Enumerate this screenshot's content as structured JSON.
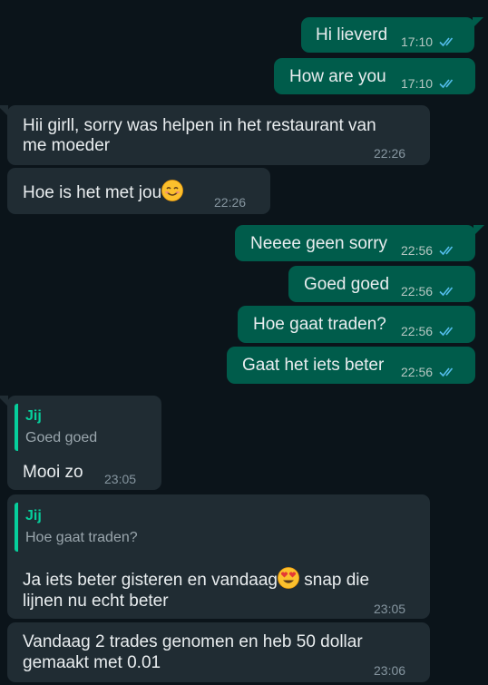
{
  "messages": [
    {
      "id": "m1",
      "dir": "out",
      "text": "Hi lieverd",
      "time": "17:10",
      "status": "read"
    },
    {
      "id": "m2",
      "dir": "out",
      "text": "How are you",
      "time": "17:10",
      "status": "read"
    },
    {
      "id": "m3",
      "dir": "in",
      "lines": [
        "Hii girll, sorry was helpen in het restaurant van",
        "me moeder"
      ],
      "time": "22:26"
    },
    {
      "id": "m4",
      "dir": "in",
      "text": "Hoe is het met jou",
      "emoji": "smiling-face-emoji",
      "time": "22:26"
    },
    {
      "id": "m5",
      "dir": "out",
      "text": "Neeee geen sorry",
      "time": "22:56",
      "status": "read"
    },
    {
      "id": "m6",
      "dir": "out",
      "text": "Goed goed",
      "time": "22:56",
      "status": "read"
    },
    {
      "id": "m7",
      "dir": "out",
      "text": "Hoe gaat traden?",
      "time": "22:56",
      "status": "read"
    },
    {
      "id": "m8",
      "dir": "out",
      "text": "Gaat het iets beter",
      "time": "22:56",
      "status": "read"
    },
    {
      "id": "m9",
      "dir": "in",
      "quote": {
        "author": "Jij",
        "text": "Goed goed"
      },
      "text": "Mooi zo",
      "time": "23:05"
    },
    {
      "id": "m10",
      "dir": "in",
      "quote": {
        "author": "Jij",
        "text": "Hoe gaat traden?"
      },
      "line1a": "Ja iets beter gisteren en vandaag",
      "emoji": "heart-eyes-emoji",
      "line1b": " snap die",
      "line2": "lijnen nu echt beter",
      "time": "23:05"
    },
    {
      "id": "m11",
      "dir": "in",
      "lines": [
        "Vandaag 2 trades genomen en heb 50 dollar",
        "gemaakt met 0.01"
      ],
      "time": "23:06"
    }
  ],
  "colors": {
    "background": "#0b141a",
    "outgoing_bubble": "#005c4b",
    "incoming_bubble": "#202c33",
    "read_ticks": "#53bdeb",
    "quote_accent": "#06cf9c"
  }
}
